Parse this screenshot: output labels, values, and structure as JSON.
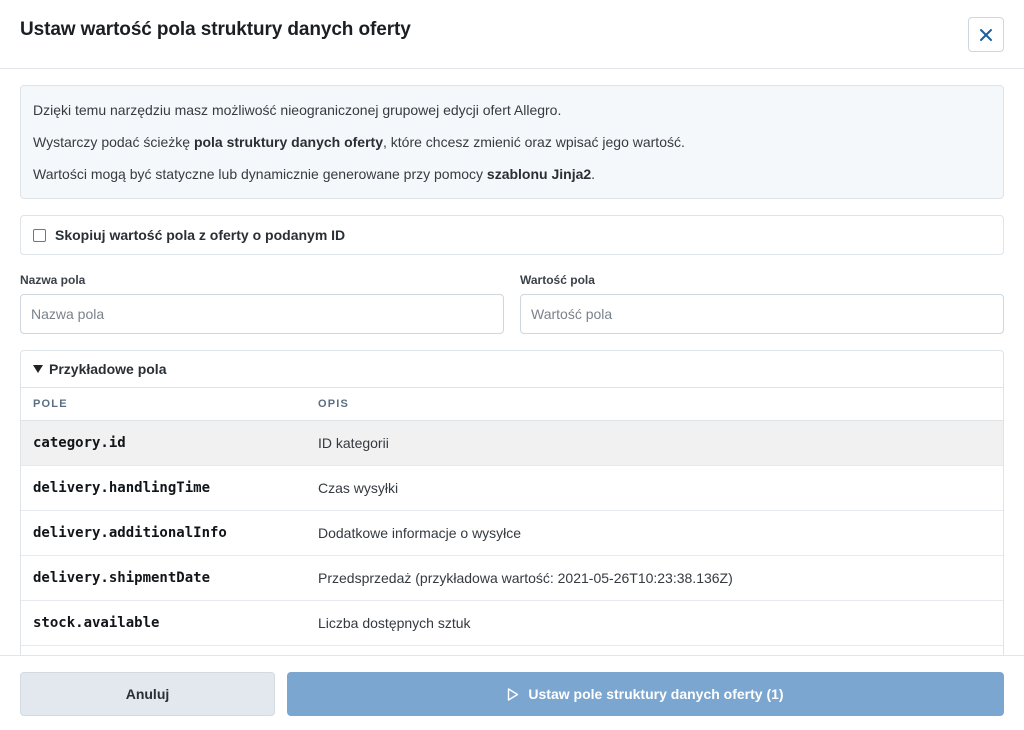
{
  "modal": {
    "title": "Ustaw wartość pola struktury danych oferty",
    "close_icon": "close-icon"
  },
  "info": {
    "line1": "Dzięki temu narzędziu masz możliwość nieograniczonej grupowej edycji ofert Allegro.",
    "line2_pre": "Wystarczy podać ścieżkę ",
    "line2_bold": "pola struktury danych oferty",
    "line2_post": ", które chcesz zmienić oraz wpisać jego wartość.",
    "line3_pre": "Wartości mogą być statyczne lub dynamicznie generowane przy pomocy ",
    "line3_bold": "szablonu Jinja2",
    "line3_post": "."
  },
  "copy_option": {
    "label": "Skopiuj wartość pola z oferty o podanym ID",
    "checked": false
  },
  "fields": {
    "name_label": "Nazwa pola",
    "name_placeholder": "Nazwa pola",
    "name_value": "",
    "value_label": "Wartość pola",
    "value_placeholder": "Wartość pola",
    "value_value": ""
  },
  "examples": {
    "summary": "Przykładowe pola",
    "columns": [
      "POLE",
      "OPIS"
    ],
    "rows": [
      {
        "key": "category.id",
        "desc": "ID kategorii"
      },
      {
        "key": "delivery.handlingTime",
        "desc": "Czas wysyłki"
      },
      {
        "key": "delivery.additionalInfo",
        "desc": "Dodatkowe informacje o wysyłce"
      },
      {
        "key": "delivery.shipmentDate",
        "desc": "Przedsprzedaż (przykładowa wartość: 2021-05-26T10:23:38.136Z)"
      },
      {
        "key": "stock.available",
        "desc": "Liczba dostępnych sztuk"
      }
    ]
  },
  "footer": {
    "cancel_label": "Anuluj",
    "submit_label": "Ustaw pole struktury danych oferty (1)",
    "submit_icon": "play-icon"
  },
  "colors": {
    "primary_disabled": "#7ba6cf",
    "close_icon": "#1c5f9b",
    "info_bg": "#f5f8fa"
  }
}
